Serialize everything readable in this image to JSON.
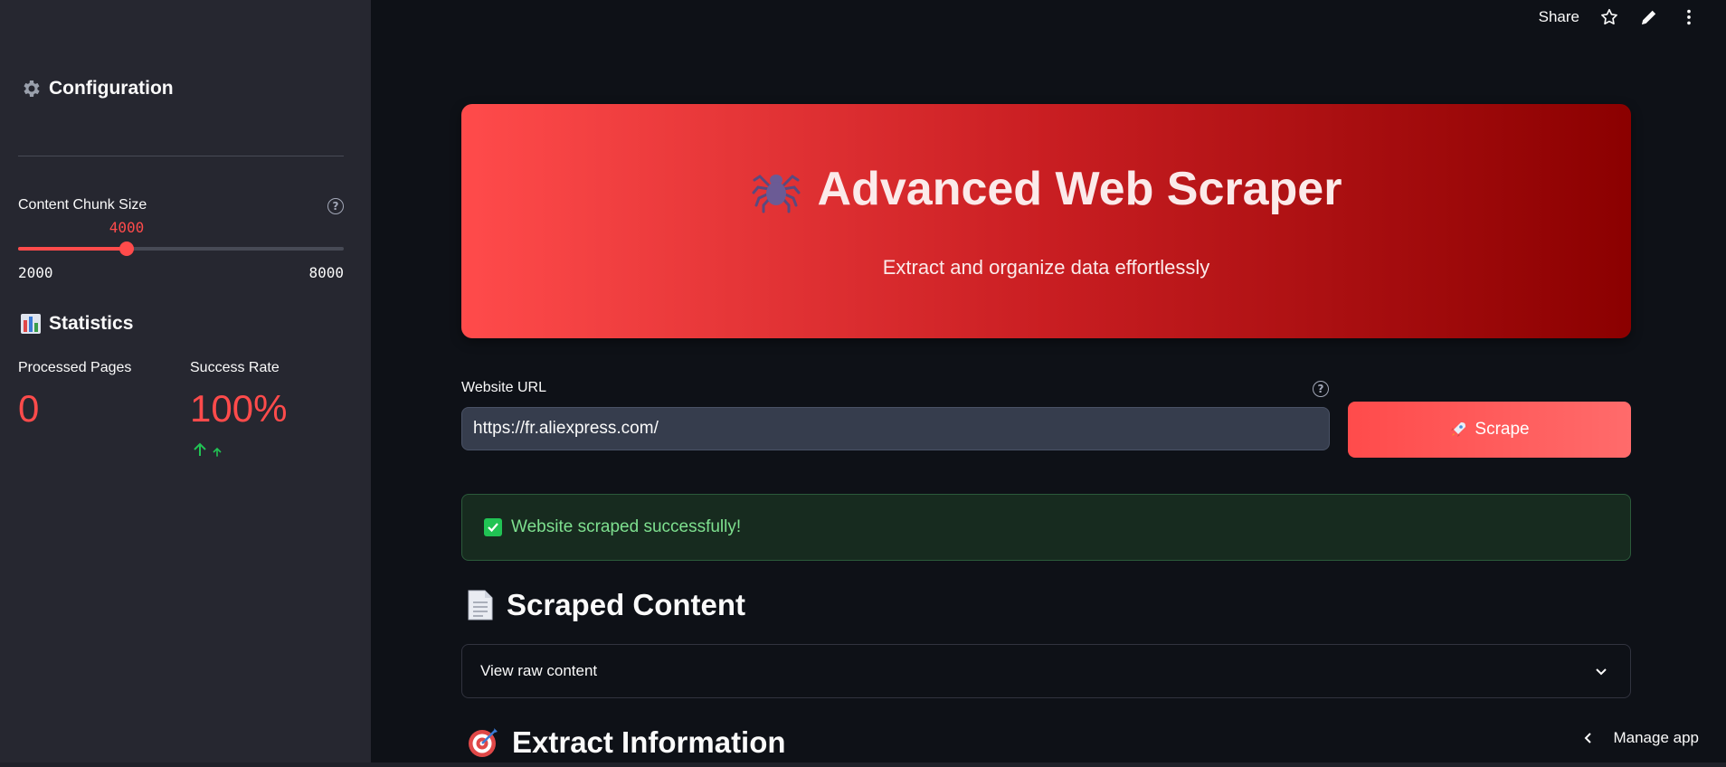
{
  "toolbar": {
    "share_label": "Share",
    "icons": [
      "star-icon",
      "pencil-icon",
      "more-vert-icon"
    ]
  },
  "sidebar": {
    "config_title": "Configuration",
    "slider": {
      "label": "Content Chunk Size",
      "value": "4000",
      "min": "2000",
      "max": "8000",
      "fraction": 0.3333
    },
    "stats_title": "Statistics",
    "metrics": [
      {
        "label": "Processed Pages",
        "value": "0"
      },
      {
        "label": "Success Rate",
        "value": "100%"
      }
    ]
  },
  "hero": {
    "title": "Advanced Web Scraper",
    "subtitle": "Extract and organize data effortlessly"
  },
  "url": {
    "label": "Website URL",
    "value": "https://fr.aliexpress.com/",
    "help": "?"
  },
  "scrape_button": {
    "label": "Scrape"
  },
  "success": {
    "message": "Website scraped successfully!"
  },
  "scraped": {
    "title": "Scraped Content",
    "expander_label": "View raw content"
  },
  "extract": {
    "title": "Extract Information"
  },
  "manage": {
    "label": "Manage app"
  },
  "colors": {
    "accent": "#ff4b4b",
    "success": "#21c354",
    "background": "#0e1117",
    "sidebar": "#262730"
  }
}
